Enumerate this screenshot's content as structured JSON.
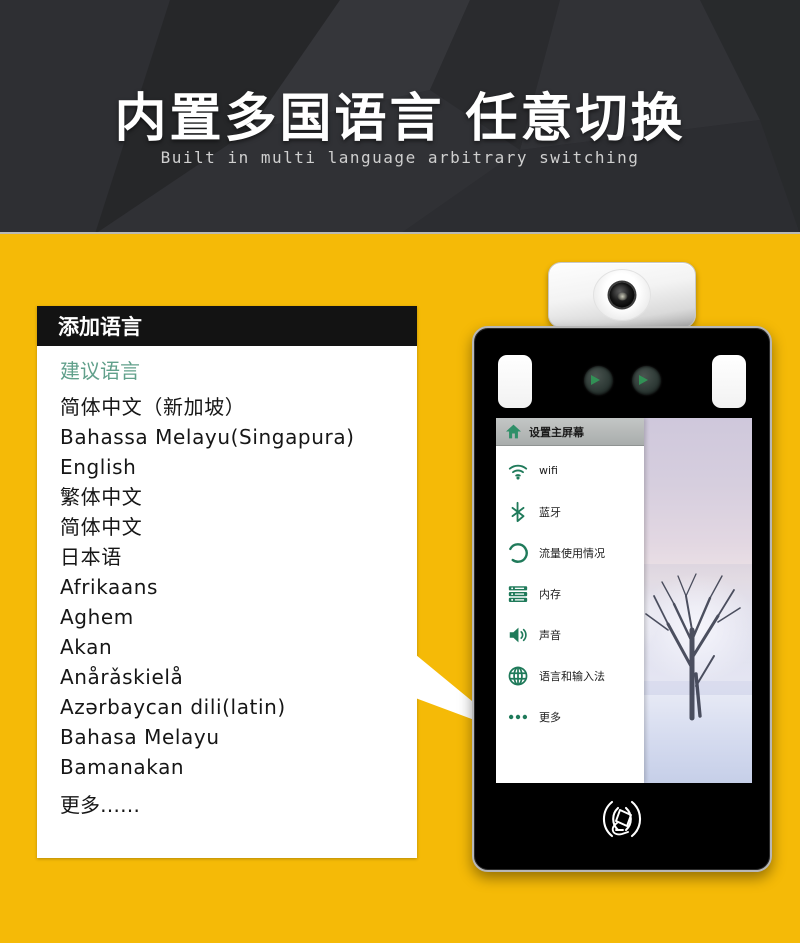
{
  "header": {
    "title": "内置多国语言 任意切换",
    "subtitle": "Built in multi language arbitrary switching",
    "bg_color": "#2b2c30"
  },
  "theme": {
    "accent_yellow": "#f5ba07",
    "panel_header_bg": "#131313",
    "section_green": "#61a08b",
    "menu_icon_green": "#1f7a5a",
    "highlight_red": "#ee2222"
  },
  "language_panel": {
    "title": "添加语言",
    "section_label": "建议语言",
    "items": [
      "简体中文（新加坡）",
      "Bahassa Melayu(Singapura)",
      "English",
      "繁体中文",
      "简体中文",
      "日本语",
      "Afrikaans",
      "Aghem",
      "Akan",
      "Anårǎskielå",
      "Azərbaycan dili(latin)",
      "Bahasa Melayu",
      "Bamanakan"
    ],
    "more_label": "更多……"
  },
  "device": {
    "screen": {
      "menu": {
        "header": {
          "label": "设置主屏幕",
          "icon": "home-icon"
        },
        "items": [
          {
            "label": "wifi",
            "icon": "wifi-icon"
          },
          {
            "label": "蓝牙",
            "icon": "bluetooth-icon"
          },
          {
            "label": "流量使用情况",
            "icon": "data-usage-icon"
          },
          {
            "label": "内存",
            "icon": "storage-icon"
          },
          {
            "label": "声音",
            "icon": "sound-icon"
          },
          {
            "label": "语言和输入法",
            "icon": "globe-icon"
          },
          {
            "label": "更多",
            "icon": "more-dots-icon"
          }
        ],
        "highlighted_item": "语言和输入法"
      },
      "wallpaper": "winter-snow-tree"
    },
    "nfc_icon": "nfc-card-reader-icon",
    "camera_module": "top-camera-module",
    "sensors": [
      "dual-lens-sensor-left",
      "dual-lens-sensor-right"
    ],
    "ir_panels": [
      "ir-fill-light-left",
      "ir-fill-light-right"
    ]
  }
}
